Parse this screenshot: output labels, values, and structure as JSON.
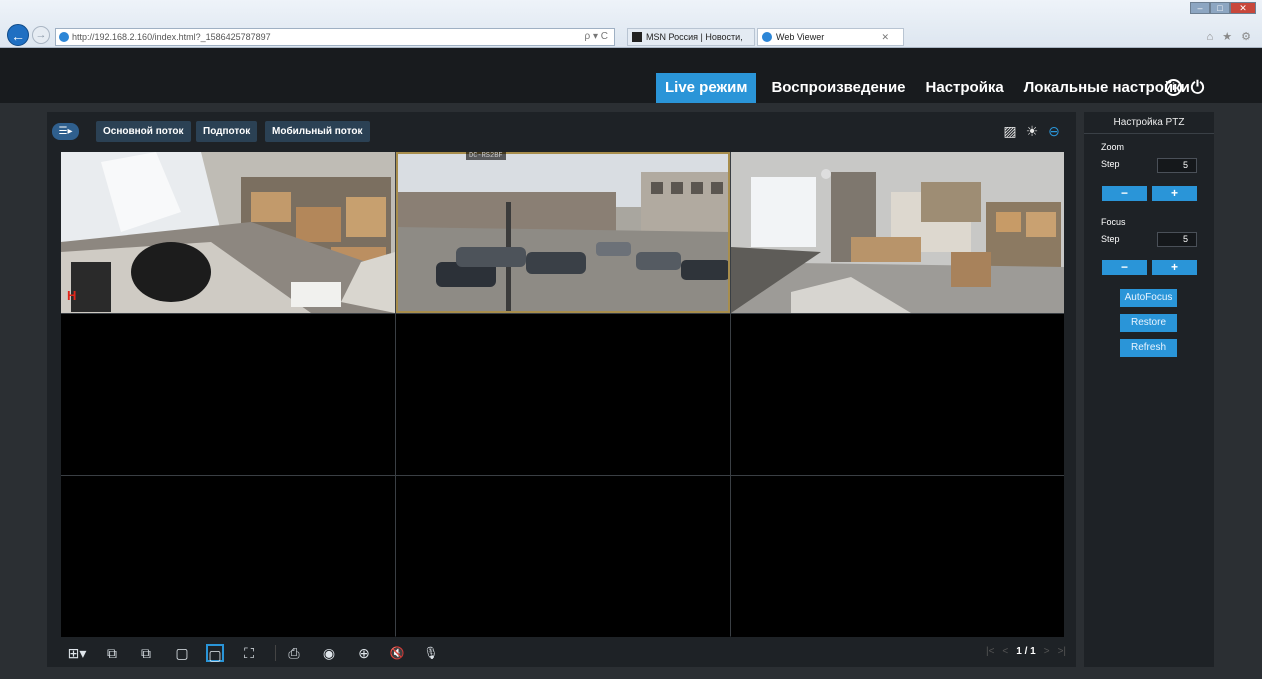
{
  "browser": {
    "url": "http://192.168.2.160/index.html?_1586425787897",
    "tabs": [
      {
        "label": "MSN Россия | Новости, фото,..."
      },
      {
        "label": "Web Viewer"
      }
    ],
    "search_tools": "ρ ▾ C",
    "window_buttons": {
      "min": "–",
      "max": "□",
      "close": "✕"
    },
    "tab_close": "✕",
    "toolbar_icons": "⌂ ★ ⚙"
  },
  "header": {
    "menu": [
      {
        "label": "Live режим",
        "active": true
      },
      {
        "label": "Воспроизведение",
        "active": false
      },
      {
        "label": "Настройка",
        "active": false
      },
      {
        "label": "Локальные настройки",
        "active": false
      }
    ],
    "info_icon": "i",
    "power_icon": "⏻"
  },
  "streams": {
    "toggle_icon": "☰▸",
    "main": "Основной поток",
    "sub": "Подпоток",
    "mobile": "Мобильный поток"
  },
  "top_icons": {
    "image": "▨",
    "brightness": "☀",
    "ptz": "⊖"
  },
  "cameras": {
    "cam1_mark": "H",
    "cam2_label": "DC-RS2BF"
  },
  "toolbar_icons": {
    "layout": "⊞▾",
    "prev": "⧉",
    "next": "⧉",
    "single": "▢",
    "original": "▢",
    "fullscreen": "⛶",
    "record": "⎙",
    "snapshot": "◉",
    "zoom": "⊕",
    "mute": "🔇",
    "mic": "🎙"
  },
  "pager": {
    "first": "|<",
    "prev": "<",
    "current": "1 / 1",
    "next": ">",
    "last": ">|"
  },
  "ptz": {
    "title": "Настройка PTZ",
    "zoom_label": "Zoom",
    "zoom_step_label": "Step",
    "zoom_step": "5",
    "focus_label": "Focus",
    "focus_step_label": "Step",
    "focus_step": "5",
    "minus": "−",
    "plus": "+",
    "autofocus": "AutoFocus",
    "restore": "Restore",
    "refresh": "Refresh"
  },
  "colors": {
    "accent": "#2a95d8",
    "header_bg": "#181b1e",
    "panel_bg": "#1e2226",
    "selected_outline": "#a88e4d"
  }
}
